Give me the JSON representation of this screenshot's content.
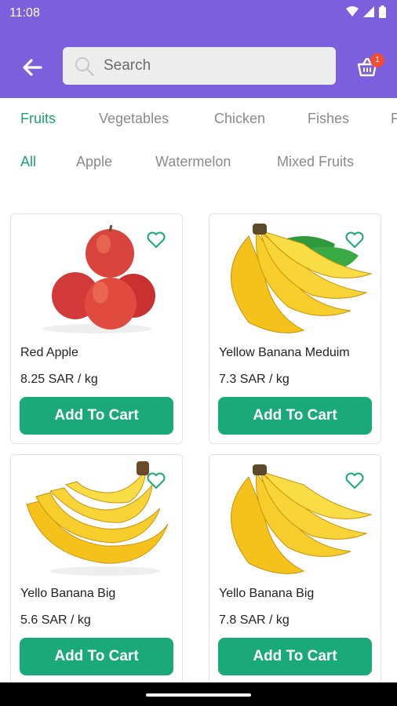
{
  "status_bar": {
    "time": "11:08"
  },
  "search": {
    "placeholder": "Search"
  },
  "cart": {
    "badge_count": "1"
  },
  "categories": [
    "Fruits",
    "Vegetables",
    "Chicken",
    "Fishes",
    "F"
  ],
  "subcategories": [
    "All",
    "Apple",
    "Watermelon",
    "Mixed Fruits"
  ],
  "products": [
    {
      "name": "Red Apple",
      "price": "8.25 SAR / kg",
      "button": "Add To Cart",
      "image": "red-apples-image"
    },
    {
      "name": "Yellow Banana Meduim",
      "price": "7.3 SAR / kg",
      "button": "Add To Cart",
      "image": "banana-bunch-with-leaf-image"
    },
    {
      "name": "Yello Banana Big",
      "price": "5.6 SAR / kg",
      "button": "Add To Cart",
      "image": "banana-bunch-image"
    },
    {
      "name": "Yello Banana Big",
      "price": "7.8 SAR / kg",
      "button": "Add To Cart",
      "image": "banana-bunch-image"
    }
  ],
  "colors": {
    "header": "#7b5fdc",
    "accent": "#1aa979",
    "badge": "#f04e37"
  }
}
